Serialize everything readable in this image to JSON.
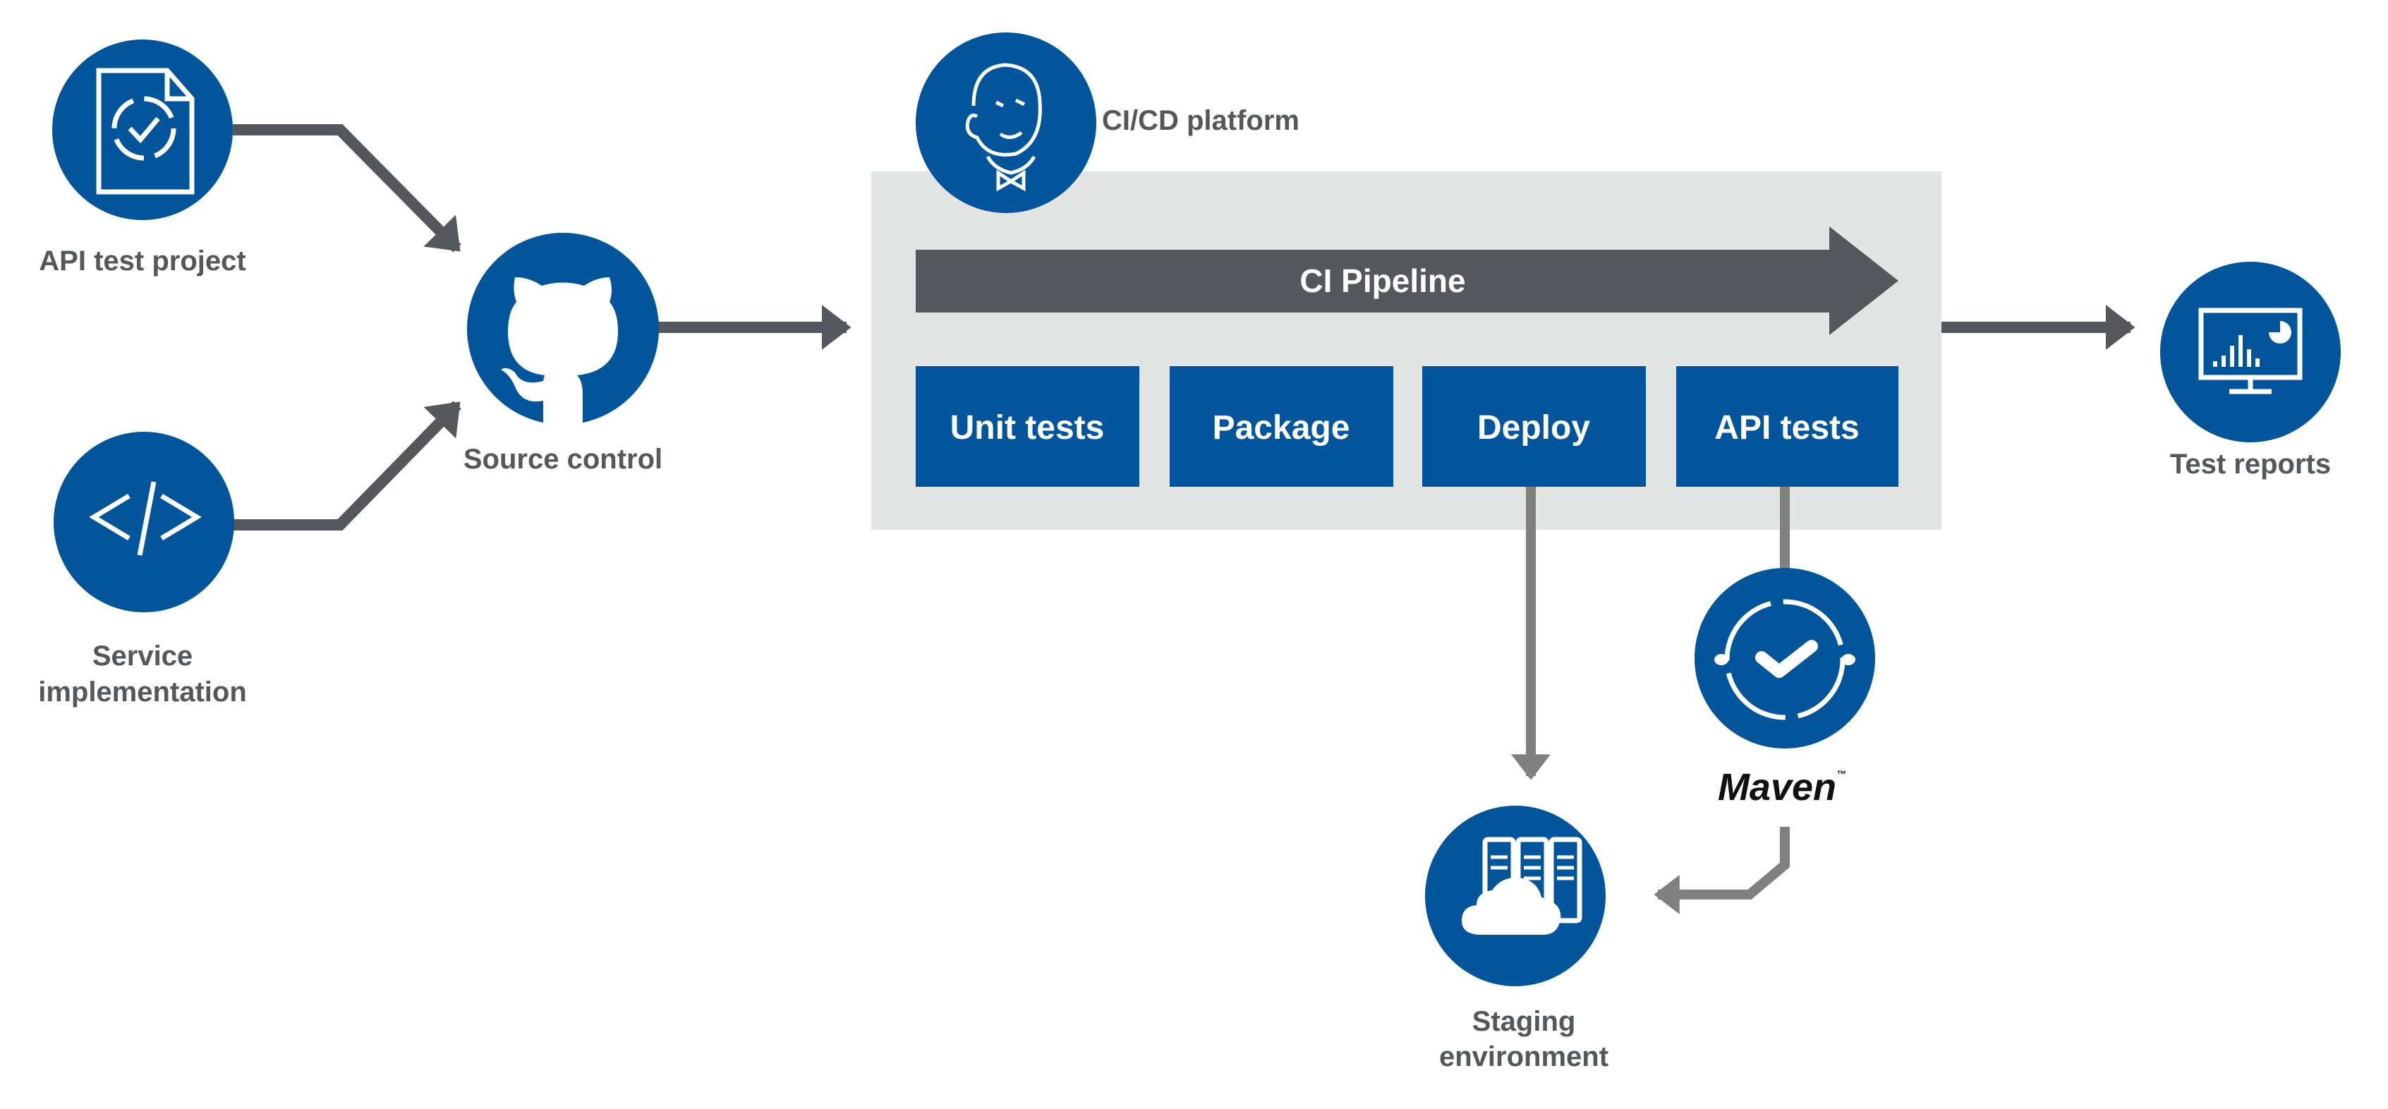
{
  "colors": {
    "node": "#02559a",
    "arrow": "#54575b",
    "connector": "#808080",
    "platform_bg": "#e3e4e4"
  },
  "nodes": {
    "api_test_project": {
      "label": "API test project",
      "icon": "test-document-icon"
    },
    "service_implementation": {
      "label_line1": "Service",
      "label_line2": "implementation",
      "icon": "code-icon"
    },
    "source_control": {
      "label": "Source control",
      "icon": "github-icon"
    },
    "ci_cd_platform": {
      "label": "CI/CD platform",
      "icon": "jenkins-icon"
    },
    "test_reports": {
      "label": "Test reports",
      "icon": "dashboard-chart-icon"
    },
    "maven": {
      "label": "Maven",
      "tm": "™",
      "icon": "test-cycle-check-icon"
    },
    "staging": {
      "label_line1": "Staging",
      "label_line2": "environment",
      "icon": "cloud-servers-icon"
    }
  },
  "pipeline": {
    "title": "CI Pipeline",
    "stages": [
      "Unit tests",
      "Package",
      "Deploy",
      "API tests"
    ]
  }
}
